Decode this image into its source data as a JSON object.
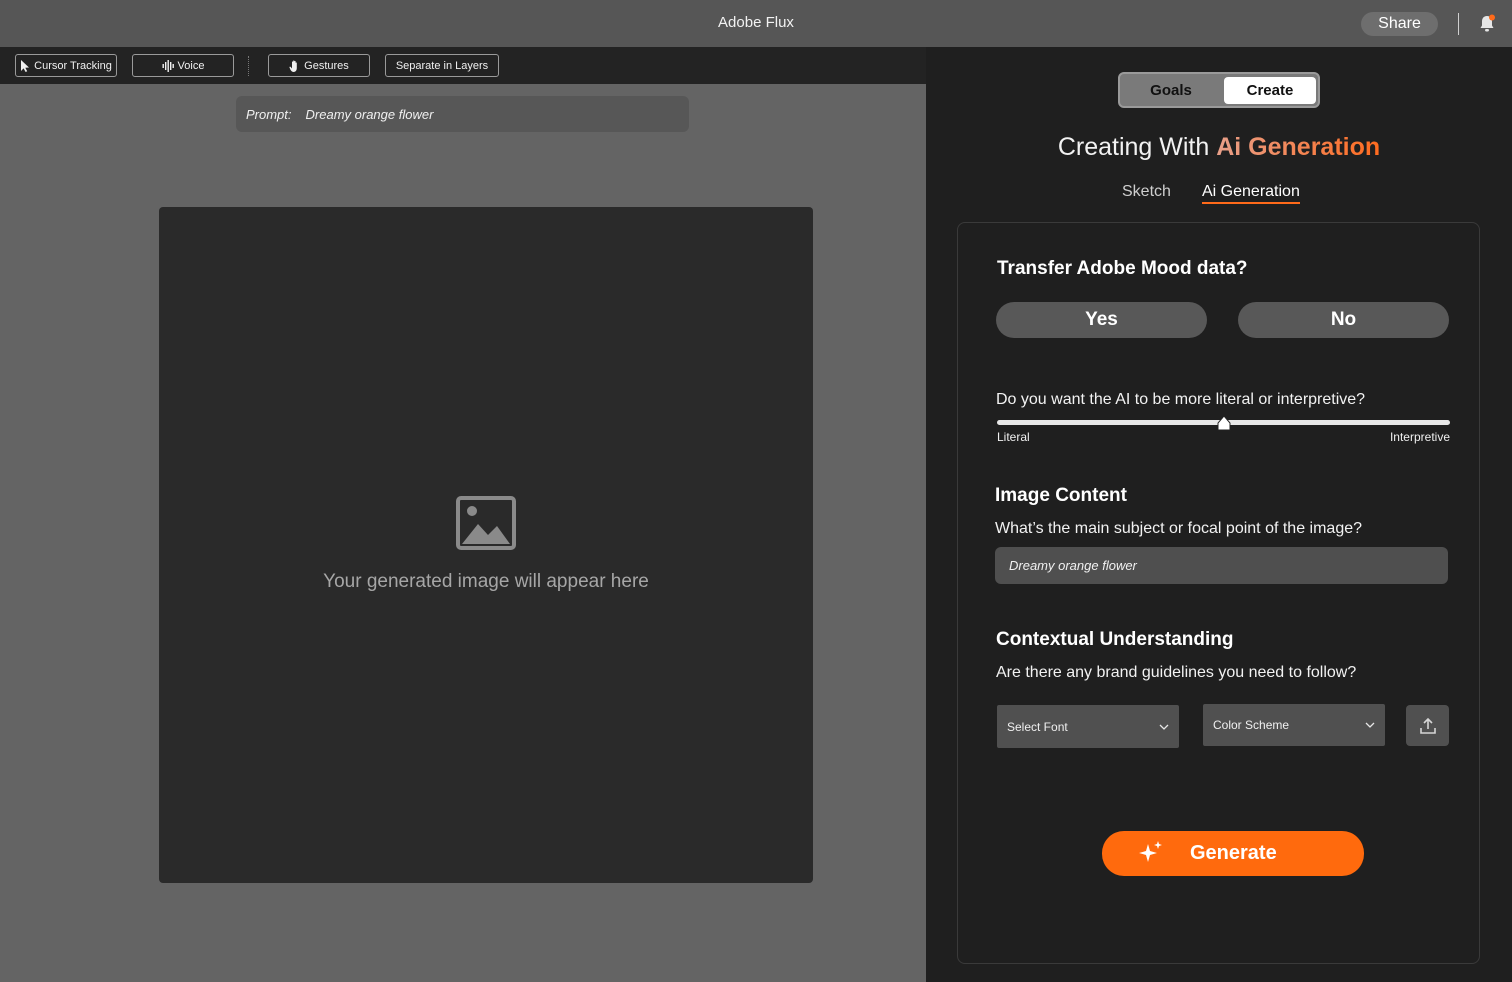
{
  "app": {
    "title": "Adobe Flux"
  },
  "header": {
    "share_label": "Share"
  },
  "toolbar": {
    "cursor_tracking": "Cursor Tracking",
    "voice": "Voice",
    "gestures": "Gestures",
    "separate_layers": "Separate in Layers"
  },
  "prompt": {
    "label": "Prompt:",
    "value": "Dreamy orange flower"
  },
  "canvas": {
    "placeholder": "Your generated image will appear here"
  },
  "panel": {
    "mode_tabs": [
      "Goals",
      "Create"
    ],
    "active_mode": "Create",
    "heading_prefix": "Creating With",
    "heading_accent": "Ai Generation",
    "subtabs": [
      "Sketch",
      "Ai Generation"
    ],
    "active_subtab": "Ai Generation"
  },
  "form": {
    "mood_question": "Transfer Adobe Mood data?",
    "yes_label": "Yes",
    "no_label": "No",
    "literal_question": "Do you want the AI to be more literal or interpretive?",
    "slider_min_label": "Literal",
    "slider_max_label": "Interpretive",
    "slider_value": 0.5,
    "image_content_title": "Image Content",
    "image_content_question": "What’s the main subject or focal point of the image?",
    "image_content_value": "Dreamy orange flower",
    "context_title": "Contextual Understanding",
    "context_question": "Are there any brand guidelines you need to follow?",
    "font_select": "Select Font",
    "color_select": "Color Scheme",
    "generate_label": "Generate"
  },
  "colors": {
    "accent": "#ff6a0d",
    "panel_bg": "#1f1f1f",
    "canvas_bg": "#2a2a2a",
    "notification_dot": "#ff6a1a"
  }
}
